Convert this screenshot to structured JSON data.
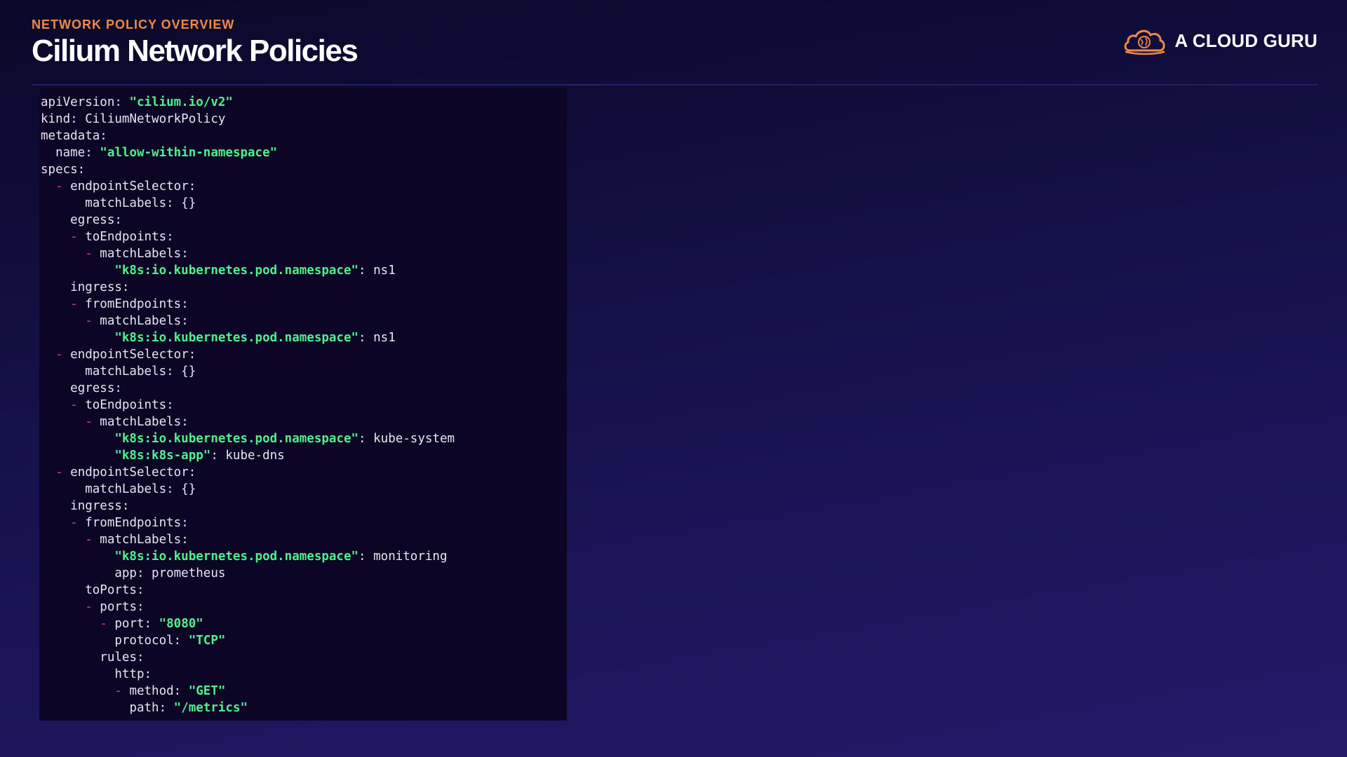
{
  "header": {
    "eyebrow": "NETWORK POLICY OVERVIEW",
    "title": "Cilium Network Policies"
  },
  "brand": {
    "name": "A CLOUD GURU",
    "logo_icon": "cloud-logo-icon",
    "logo_color": "#f0884a"
  },
  "colors": {
    "background": "#15114a",
    "code_background": "#0d0526",
    "string": "#4df28c",
    "dash": "#e8425c",
    "eyebrow": "#f0884a",
    "text": "#e6e6f0"
  },
  "code_lines": [
    {
      "indent": "",
      "dash": "",
      "text": "apiVersion: ",
      "str": "\"cilium.io/v2\"",
      "after": ""
    },
    {
      "indent": "",
      "dash": "",
      "text": "kind: CiliumNetworkPolicy",
      "str": "",
      "after": ""
    },
    {
      "indent": "",
      "dash": "",
      "text": "metadata:",
      "str": "",
      "after": ""
    },
    {
      "indent": "  ",
      "dash": "",
      "text": "name: ",
      "str": "\"allow-within-namespace\"",
      "after": ""
    },
    {
      "indent": "",
      "dash": "",
      "text": "specs:",
      "str": "",
      "after": ""
    },
    {
      "indent": "  ",
      "dash": "- ",
      "text": "endpointSelector:",
      "str": "",
      "after": ""
    },
    {
      "indent": "      ",
      "dash": "",
      "text": "matchLabels: {}",
      "str": "",
      "after": ""
    },
    {
      "indent": "    ",
      "dash": "",
      "text": "egress:",
      "str": "",
      "after": ""
    },
    {
      "indent": "    ",
      "dash": "- ",
      "text": "toEndpoints:",
      "str": "",
      "after": ""
    },
    {
      "indent": "      ",
      "dash": "- ",
      "text": "matchLabels:",
      "str": "",
      "after": ""
    },
    {
      "indent": "          ",
      "dash": "",
      "text": "",
      "str": "\"k8s:io.kubernetes.pod.namespace\"",
      "after": ": ns1"
    },
    {
      "indent": "    ",
      "dash": "",
      "text": "ingress:",
      "str": "",
      "after": ""
    },
    {
      "indent": "    ",
      "dash": "- ",
      "text": "fromEndpoints:",
      "str": "",
      "after": ""
    },
    {
      "indent": "      ",
      "dash": "- ",
      "text": "matchLabels:",
      "str": "",
      "after": ""
    },
    {
      "indent": "          ",
      "dash": "",
      "text": "",
      "str": "\"k8s:io.kubernetes.pod.namespace\"",
      "after": ": ns1"
    },
    {
      "indent": "  ",
      "dash": "- ",
      "text": "endpointSelector:",
      "str": "",
      "after": ""
    },
    {
      "indent": "      ",
      "dash": "",
      "text": "matchLabels: {}",
      "str": "",
      "after": ""
    },
    {
      "indent": "    ",
      "dash": "",
      "text": "egress:",
      "str": "",
      "after": ""
    },
    {
      "indent": "    ",
      "dash": "- ",
      "text": "toEndpoints:",
      "str": "",
      "after": ""
    },
    {
      "indent": "      ",
      "dash": "- ",
      "text": "matchLabels:",
      "str": "",
      "after": ""
    },
    {
      "indent": "          ",
      "dash": "",
      "text": "",
      "str": "\"k8s:io.kubernetes.pod.namespace\"",
      "after": ": kube-system"
    },
    {
      "indent": "          ",
      "dash": "",
      "text": "",
      "str": "\"k8s:k8s-app\"",
      "after": ": kube-dns"
    },
    {
      "indent": "  ",
      "dash": "- ",
      "text": "endpointSelector:",
      "str": "",
      "after": ""
    },
    {
      "indent": "      ",
      "dash": "",
      "text": "matchLabels: {}",
      "str": "",
      "after": ""
    },
    {
      "indent": "    ",
      "dash": "",
      "text": "ingress:",
      "str": "",
      "after": ""
    },
    {
      "indent": "    ",
      "dash": "- ",
      "text": "fromEndpoints:",
      "str": "",
      "after": ""
    },
    {
      "indent": "      ",
      "dash": "- ",
      "text": "matchLabels:",
      "str": "",
      "after": ""
    },
    {
      "indent": "          ",
      "dash": "",
      "text": "",
      "str": "\"k8s:io.kubernetes.pod.namespace\"",
      "after": ": monitoring"
    },
    {
      "indent": "          ",
      "dash": "",
      "text": "app: prometheus",
      "str": "",
      "after": ""
    },
    {
      "indent": "      ",
      "dash": "",
      "text": "toPorts:",
      "str": "",
      "after": ""
    },
    {
      "indent": "      ",
      "dash": "- ",
      "text": "ports:",
      "str": "",
      "after": ""
    },
    {
      "indent": "        ",
      "dash": "- ",
      "text": "port: ",
      "str": "\"8080\"",
      "after": ""
    },
    {
      "indent": "          ",
      "dash": "",
      "text": "protocol: ",
      "str": "\"TCP\"",
      "after": ""
    },
    {
      "indent": "        ",
      "dash": "",
      "text": "rules:",
      "str": "",
      "after": ""
    },
    {
      "indent": "          ",
      "dash": "",
      "text": "http:",
      "str": "",
      "after": ""
    },
    {
      "indent": "          ",
      "dash": "- ",
      "text": "method: ",
      "str": "\"GET\"",
      "after": ""
    },
    {
      "indent": "            ",
      "dash": "",
      "text": "path: ",
      "str": "\"/metrics\"",
      "after": ""
    }
  ]
}
